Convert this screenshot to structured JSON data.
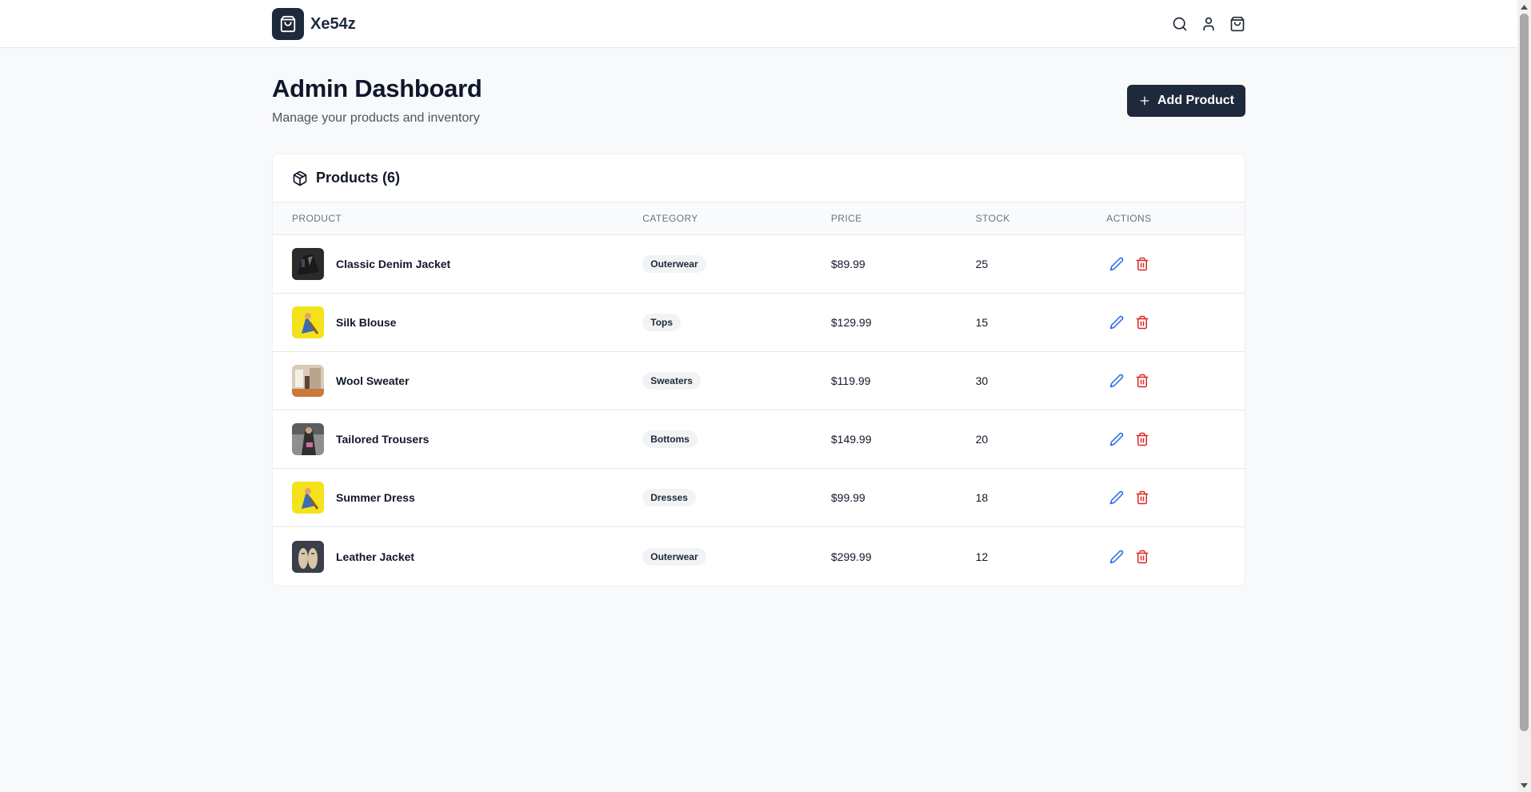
{
  "header": {
    "brand_name": "Xe54z",
    "icons": [
      "shopping-bag-icon",
      "search-icon",
      "user-icon",
      "cart-icon"
    ]
  },
  "page": {
    "title": "Admin Dashboard",
    "subtitle": "Manage your products and inventory",
    "add_button_label": "Add Product"
  },
  "products_card": {
    "title": "Products (6)",
    "columns": [
      "Product",
      "Category",
      "Price",
      "Stock",
      "Actions"
    ],
    "rows": [
      {
        "name": "Classic Denim Jacket",
        "category": "Outerwear",
        "price": "$89.99",
        "stock": "25"
      },
      {
        "name": "Silk Blouse",
        "category": "Tops",
        "price": "$129.99",
        "stock": "15"
      },
      {
        "name": "Wool Sweater",
        "category": "Sweaters",
        "price": "$119.99",
        "stock": "30"
      },
      {
        "name": "Tailored Trousers",
        "category": "Bottoms",
        "price": "$149.99",
        "stock": "20"
      },
      {
        "name": "Summer Dress",
        "category": "Dresses",
        "price": "$99.99",
        "stock": "18"
      },
      {
        "name": "Leather Jacket",
        "category": "Outerwear",
        "price": "$299.99",
        "stock": "12"
      }
    ]
  },
  "colors": {
    "primary": "#1e293b",
    "edit_icon": "#2563eb",
    "delete_icon": "#dc2626",
    "page_bg": "#f8f9fb"
  }
}
